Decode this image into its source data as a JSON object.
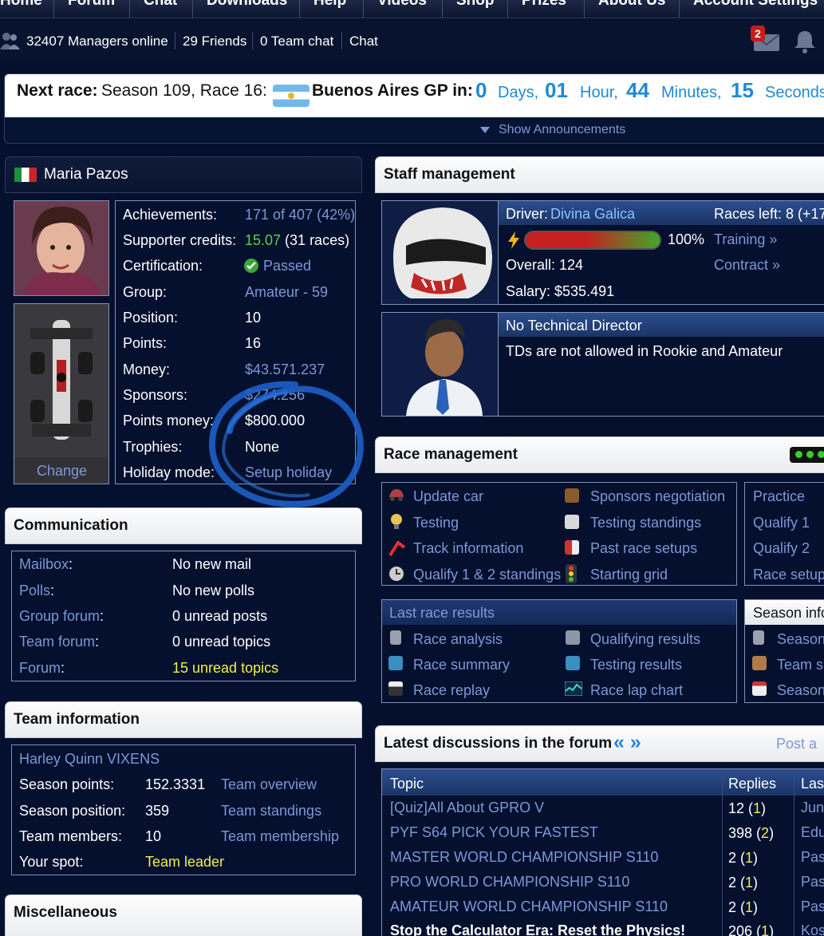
{
  "nav": {
    "items": [
      "Home",
      "Forum",
      "Chat",
      "Downloads",
      "Help",
      "Videos",
      "Shop",
      "Prizes",
      "About Us",
      "Account Settings"
    ]
  },
  "status": {
    "managers": "32407 Managers online",
    "friends": "29 Friends",
    "team_chat": "0 Team chat",
    "chat": "Chat",
    "mail_count": "2"
  },
  "race": {
    "label": "Next race:",
    "season_race": "Season 109, Race 16:",
    "gp": "Buenos Aires GP in:",
    "days": "0",
    "days_unit": "Days,",
    "hours": "01",
    "hours_unit": "Hour,",
    "minutes": "44",
    "minutes_unit": "Minutes,",
    "seconds": "15",
    "seconds_unit": "Seconds",
    "announcements": "Show Announcements"
  },
  "profile": {
    "name": "Maria Pazos",
    "change": "Change",
    "rows": [
      {
        "label": "Achievements:",
        "value": "171 of 407 (42%)"
      },
      {
        "label": "Supporter credits:",
        "value": "15.07",
        "value2": " (31 races)"
      },
      {
        "label": "Certification:",
        "value": "Passed"
      },
      {
        "label": "Group:",
        "value": "Amateur - 59"
      },
      {
        "label": "Position:",
        "value": "10"
      },
      {
        "label": "Points:",
        "value": "16"
      },
      {
        "label": "Money:",
        "value": "$43.571.237"
      },
      {
        "label": "Sponsors:",
        "value": "$274.256"
      },
      {
        "label": "Points money:",
        "value": "$800.000"
      },
      {
        "label": "Trophies:",
        "value": "None"
      },
      {
        "label": "Holiday mode:",
        "value": "Setup holiday"
      }
    ]
  },
  "communication": {
    "title": "Communication",
    "rows": [
      {
        "label": "Mailbox",
        "value": "No new mail"
      },
      {
        "label": "Polls",
        "value": "No new polls"
      },
      {
        "label": "Group forum",
        "value": "0 unread posts"
      },
      {
        "label": "Team forum",
        "value": "0 unread topics"
      },
      {
        "label": "Forum",
        "value": "15 unread topics"
      }
    ]
  },
  "team": {
    "title": "Team information",
    "name": "Harley Quinn VIXENS",
    "rows": [
      {
        "label": "Season points:",
        "value": "152.3331",
        "link": "Team overview"
      },
      {
        "label": "Season position:",
        "value": "359",
        "link": "Team standings"
      },
      {
        "label": "Team members:",
        "value": "10",
        "link": "Team membership"
      },
      {
        "label": "Your spot:",
        "value": "Team leader"
      }
    ]
  },
  "misc": {
    "title": "Miscellaneous"
  },
  "staff": {
    "title": "Staff management",
    "driver_label": "Driver:",
    "driver_name": "Divina Galica",
    "races_left": "Races left: 8 (+17",
    "energy": "100%",
    "energy_fraction": 1.0,
    "training": "Training »",
    "overall": "Overall: 124",
    "contract": "Contract »",
    "salary": "Salary: $535.491",
    "td_title": "No Technical Director",
    "td_note": "TDs are not allowed in Rookie and Amateur"
  },
  "racemgmt": {
    "title": "Race management",
    "left": [
      "Update car",
      "Testing",
      "Track information",
      "Qualify 1 & 2 standings"
    ],
    "mid": [
      "Sponsors negotiation",
      "Testing standings",
      "Past race setups",
      "Starting grid"
    ],
    "right": [
      "Practice",
      "Qualify 1",
      "Qualify 2",
      "Race setup"
    ],
    "last_title": "Last race results",
    "last_left": [
      "Race analysis",
      "Race summary",
      "Race replay"
    ],
    "last_mid": [
      "Qualifying results",
      "Testing results",
      "Race lap chart"
    ],
    "season_title": "Season info",
    "season_items": [
      "Season",
      "Team s",
      "Season"
    ]
  },
  "forum": {
    "title": "Latest discussions in the forum",
    "arrows": "« »",
    "post": "Post a",
    "head_topic": "Topic",
    "head_replies": "Replies",
    "head_last": "Las",
    "rows": [
      {
        "topic": "[Quiz]All About GPRO V",
        "replies": "12",
        "new": "1",
        "last": "Jun"
      },
      {
        "topic": "PYF S64 PICK YOUR FASTEST",
        "replies": "398",
        "new": "2",
        "last": "Edu"
      },
      {
        "topic": "MASTER WORLD CHAMPIONSHIP S110",
        "replies": "2",
        "new": "1",
        "last": "Pas"
      },
      {
        "topic": "PRO WORLD CHAMPIONSHIP S110",
        "replies": "2",
        "new": "1",
        "last": "Pas"
      },
      {
        "topic": "AMATEUR WORLD CHAMPIONSHIP S110",
        "replies": "2",
        "new": "1",
        "last": "Pas"
      },
      {
        "topic": "Stop the Calculator Era: Reset the Physics!",
        "replies": "206",
        "new": "1",
        "last": "Kos"
      }
    ]
  },
  "colors": {
    "background": "#04102e",
    "link": "#7d98d6",
    "accent": "#1d8ad8",
    "yellow": "#f0f050",
    "green": "#5bd348",
    "circle": "#1d5fc9"
  }
}
